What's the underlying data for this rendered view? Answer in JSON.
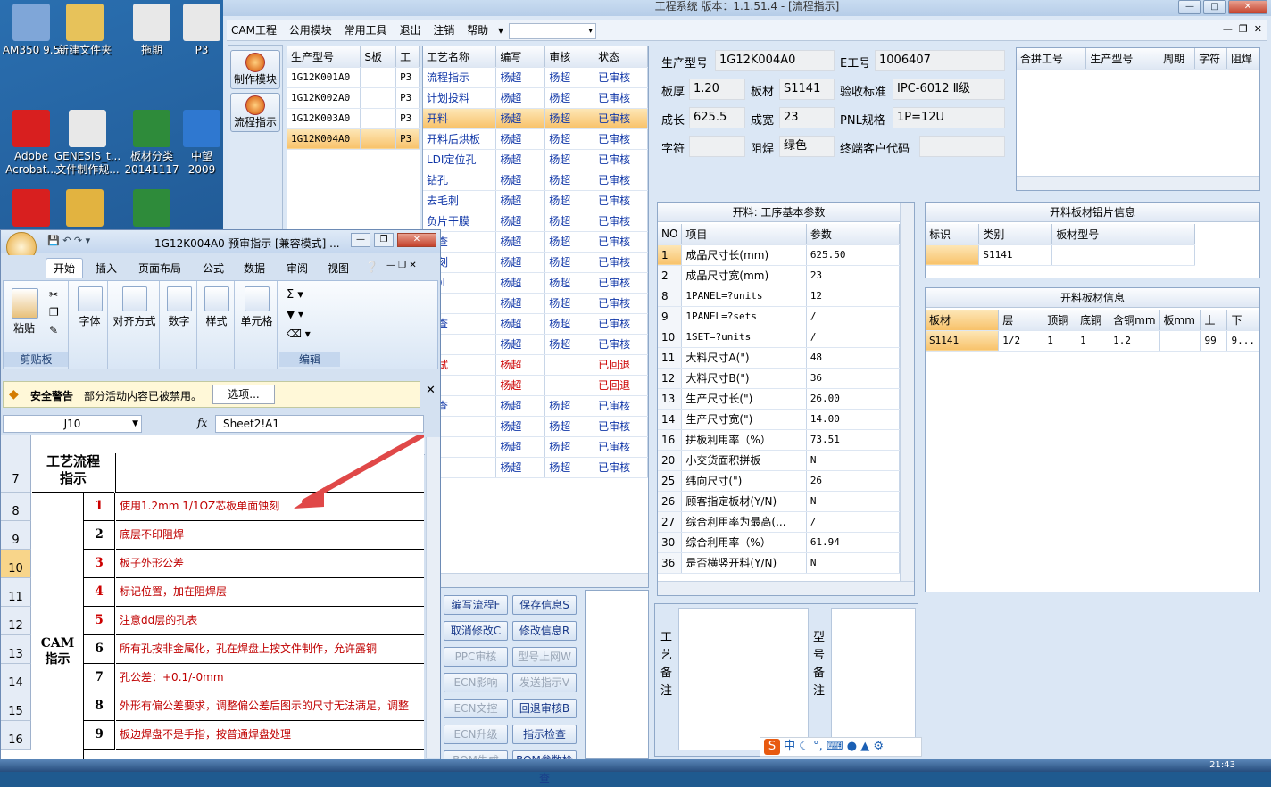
{
  "desktop": {
    "icons": [
      {
        "label": "AM350 9.5",
        "color": "#7fa6d8"
      },
      {
        "label": "新建文件夹",
        "color": "#e7c25a"
      },
      {
        "label": "拖期",
        "color": "#e8e8e8"
      },
      {
        "label": "P3",
        "color": "#e8e8e8"
      },
      {
        "label": "Adobe\nAcrobat...",
        "color": "#d81f1f"
      },
      {
        "label": "GENESIS_t...\n文件制作规...",
        "color": "#e8e8e8"
      },
      {
        "label": "板材分类\n20141117",
        "color": "#2e8b3a"
      },
      {
        "label": "中望\n2009",
        "color": "#2f78d0"
      }
    ]
  },
  "app": {
    "title": "工程系统   版本：1.1.51.4 - [流程指示]",
    "menu": [
      "CAM工程",
      "公用模块",
      "常用工具",
      "退出",
      "注销",
      "帮助"
    ],
    "side_buttons": [
      "制作模块",
      "流程指示"
    ],
    "model_list": {
      "headers": [
        "生产型号",
        "S板",
        "工"
      ],
      "rows": [
        [
          "1G12K001A0",
          "",
          "P3"
        ],
        [
          "1G12K002A0",
          "",
          "P3"
        ],
        [
          "1G12K003A0",
          "",
          "P3"
        ],
        [
          "1G12K004A0",
          "",
          "P3"
        ]
      ],
      "selected": 3
    },
    "process_list": {
      "headers": [
        "工艺名称",
        "编写",
        "审核",
        "状态"
      ],
      "rows": [
        [
          "流程指示",
          "杨超",
          "杨超",
          "已审核"
        ],
        [
          "计划投料",
          "杨超",
          "杨超",
          "已审核"
        ],
        [
          "开料",
          "杨超",
          "杨超",
          "已审核"
        ],
        [
          "开料后烘板",
          "杨超",
          "杨超",
          "已审核"
        ],
        [
          "LDI定位孔",
          "杨超",
          "杨超",
          "已审核"
        ],
        [
          "钻孔",
          "杨超",
          "杨超",
          "已审核"
        ],
        [
          "去毛刺",
          "杨超",
          "杨超",
          "已审核"
        ],
        [
          "负片干膜",
          "杨超",
          "杨超",
          "已审核"
        ],
        [
          "检查",
          "杨超",
          "杨超",
          "已审核"
        ],
        [
          "蚀刻",
          "杨超",
          "杨超",
          "已审核"
        ],
        [
          "AOI",
          "杨超",
          "杨超",
          "已审核"
        ],
        [
          "",
          "杨超",
          "杨超",
          "已审核"
        ],
        [
          "检查",
          "杨超",
          "杨超",
          "已审核"
        ],
        [
          "",
          "杨超",
          "杨超",
          "已审核"
        ],
        [
          "测试",
          "杨超",
          "",
          "已回退"
        ],
        [
          "",
          "杨超",
          "",
          "已回退"
        ],
        [
          "检查",
          "杨超",
          "杨超",
          "已审核"
        ],
        [
          "",
          "杨超",
          "杨超",
          "已审核"
        ],
        [
          "",
          "杨超",
          "杨超",
          "已审核"
        ],
        [
          "仓",
          "杨超",
          "杨超",
          "已审核"
        ]
      ],
      "selected": 2
    },
    "action_buttons": [
      {
        "label": "编写流程F",
        "disabled": false
      },
      {
        "label": "保存信息S",
        "disabled": false
      },
      {
        "label": "取消修改C",
        "disabled": false
      },
      {
        "label": "修改信息R",
        "disabled": false
      },
      {
        "label": "PPC审核",
        "disabled": true
      },
      {
        "label": "型号上网W",
        "disabled": true
      },
      {
        "label": "ECN影响",
        "disabled": true
      },
      {
        "label": "发送指示V",
        "disabled": true
      },
      {
        "label": "ECN文控",
        "disabled": true
      },
      {
        "label": "回退审核B",
        "disabled": false
      },
      {
        "label": "ECN升级",
        "disabled": true
      },
      {
        "label": "指示检查",
        "disabled": false
      },
      {
        "label": "BOM生成",
        "disabled": true
      },
      {
        "label": "BOM参数检查",
        "disabled": false
      }
    ],
    "info": {
      "model_label": "生产型号",
      "model_value": "1G12K004A0",
      "eno_label": "E工号",
      "eno_value": "1006407",
      "thick_label": "板厚",
      "thick_value": "1.20",
      "material_label": "板材",
      "material_value": "S1141",
      "std_label": "验收标准",
      "std_value": "IPC-6012 Ⅱ级",
      "len_label": "成长",
      "len_value": "625.5",
      "wid_label": "成宽",
      "wid_value": "23",
      "pnl_label": "PNL规格",
      "pnl_value": "1P=12U",
      "char_label": "字符",
      "char_value": "",
      "mask_label": "阻焊",
      "mask_value": "绿色",
      "cust_label": "终端客户代码",
      "cust_value": ""
    },
    "merge_table": {
      "headers": [
        "合拼工号",
        "生产型号",
        "周期",
        "字符",
        "阻焊"
      ]
    },
    "params": {
      "title": "开料: 工序基本参数",
      "headers": [
        "NO",
        "项目",
        "参数"
      ],
      "rows": [
        [
          "1",
          "成品尺寸长(mm)",
          "625.50"
        ],
        [
          "2",
          "成品尺寸宽(mm)",
          "23"
        ],
        [
          "8",
          "1PANEL=?units",
          "12"
        ],
        [
          "9",
          "1PANEL=?sets",
          "/"
        ],
        [
          "10",
          "1SET=?units",
          "/"
        ],
        [
          "11",
          "大料尺寸A(\")",
          "48"
        ],
        [
          "12",
          "大料尺寸B(\")",
          "36"
        ],
        [
          "13",
          "生产尺寸长(\")",
          "26.00"
        ],
        [
          "14",
          "生产尺寸宽(\")",
          "14.00"
        ],
        [
          "16",
          "拼板利用率（%）",
          "73.51"
        ],
        [
          "20",
          "小交货面积拼板",
          "N"
        ],
        [
          "25",
          "纬向尺寸(\")",
          "26"
        ],
        [
          "26",
          "顾客指定板材(Y/N)",
          "N"
        ],
        [
          "27",
          "综合利用率为最高(...",
          "/"
        ],
        [
          "30",
          "综合利用率（%）",
          "61.94"
        ],
        [
          "36",
          "是否横竖开料(Y/N)",
          "N"
        ]
      ]
    },
    "foil_info": {
      "title": "开料板材铝片信息",
      "headers": [
        "标识",
        "类别",
        "板材型号"
      ],
      "rows": [
        [
          "",
          "S1141",
          ""
        ]
      ]
    },
    "board_info": {
      "title": "开料板材信息",
      "headers": [
        "板材",
        "层",
        "顶铜",
        "底铜",
        "含铜mm",
        "板mm",
        "上",
        "下"
      ],
      "rows": [
        [
          "S1141",
          "1/2",
          "1",
          "1",
          "1.2",
          "",
          "99",
          "9..."
        ]
      ]
    },
    "remarks": {
      "process_label": "工艺备注",
      "model_label": "型号备注"
    }
  },
  "excel": {
    "title": "1G12K004A0-预审指示 [兼容模式] ...",
    "tabs": [
      "开始",
      "插入",
      "页面布局",
      "公式",
      "数据",
      "审阅",
      "视图"
    ],
    "ribbon_groups": [
      {
        "label": "剪贴板",
        "buttons": [
          "粘贴"
        ]
      },
      {
        "label": "",
        "buttons": [
          "字体"
        ]
      },
      {
        "label": "",
        "buttons": [
          "对齐方式"
        ]
      },
      {
        "label": "",
        "buttons": [
          "数字"
        ]
      },
      {
        "label": "",
        "buttons": [
          "样式"
        ]
      },
      {
        "label": "",
        "buttons": [
          "单元格"
        ]
      },
      {
        "label": "编辑",
        "buttons": []
      }
    ],
    "security": {
      "title": "安全警告",
      "text": "部分活动内容已被禁用。",
      "button": "选项..."
    },
    "namebox": "J10",
    "formula": "Sheet2!A1",
    "columns": [
      "A",
      "B",
      "C",
      "D",
      "E",
      "F",
      "G"
    ],
    "process_header": "工艺流程\n指示",
    "cam_label": "CAM\n指示",
    "rows": [
      {
        "row": "7",
        "num": "",
        "text": ""
      },
      {
        "row": "8",
        "num": "1",
        "text": "使用1.2mm 1/1OZ芯板单面蚀刻",
        "num_red": true
      },
      {
        "row": "9",
        "num": "2",
        "text": "底层不印阻焊"
      },
      {
        "row": "10",
        "num": "3",
        "text": "板子外形公差",
        "num_red": true
      },
      {
        "row": "11",
        "num": "4",
        "text": "标记位置，加在阻焊层",
        "num_red": true
      },
      {
        "row": "12",
        "num": "5",
        "text": "注意dd层的孔表",
        "num_red": true
      },
      {
        "row": "13",
        "num": "6",
        "text": "所有孔按非金属化，孔在焊盘上按文件制作，允许露铜"
      },
      {
        "row": "14",
        "num": "7",
        "text": "孔公差：+0.1/-0mm"
      },
      {
        "row": "15",
        "num": "8",
        "text": "外形有偏公差要求，调整偏公差后图示的尺寸无法满足，调整"
      },
      {
        "row": "16",
        "num": "9",
        "text": "板边焊盘不是手指，按普通焊盘处理"
      }
    ]
  },
  "tray": {
    "time": "21:43"
  }
}
